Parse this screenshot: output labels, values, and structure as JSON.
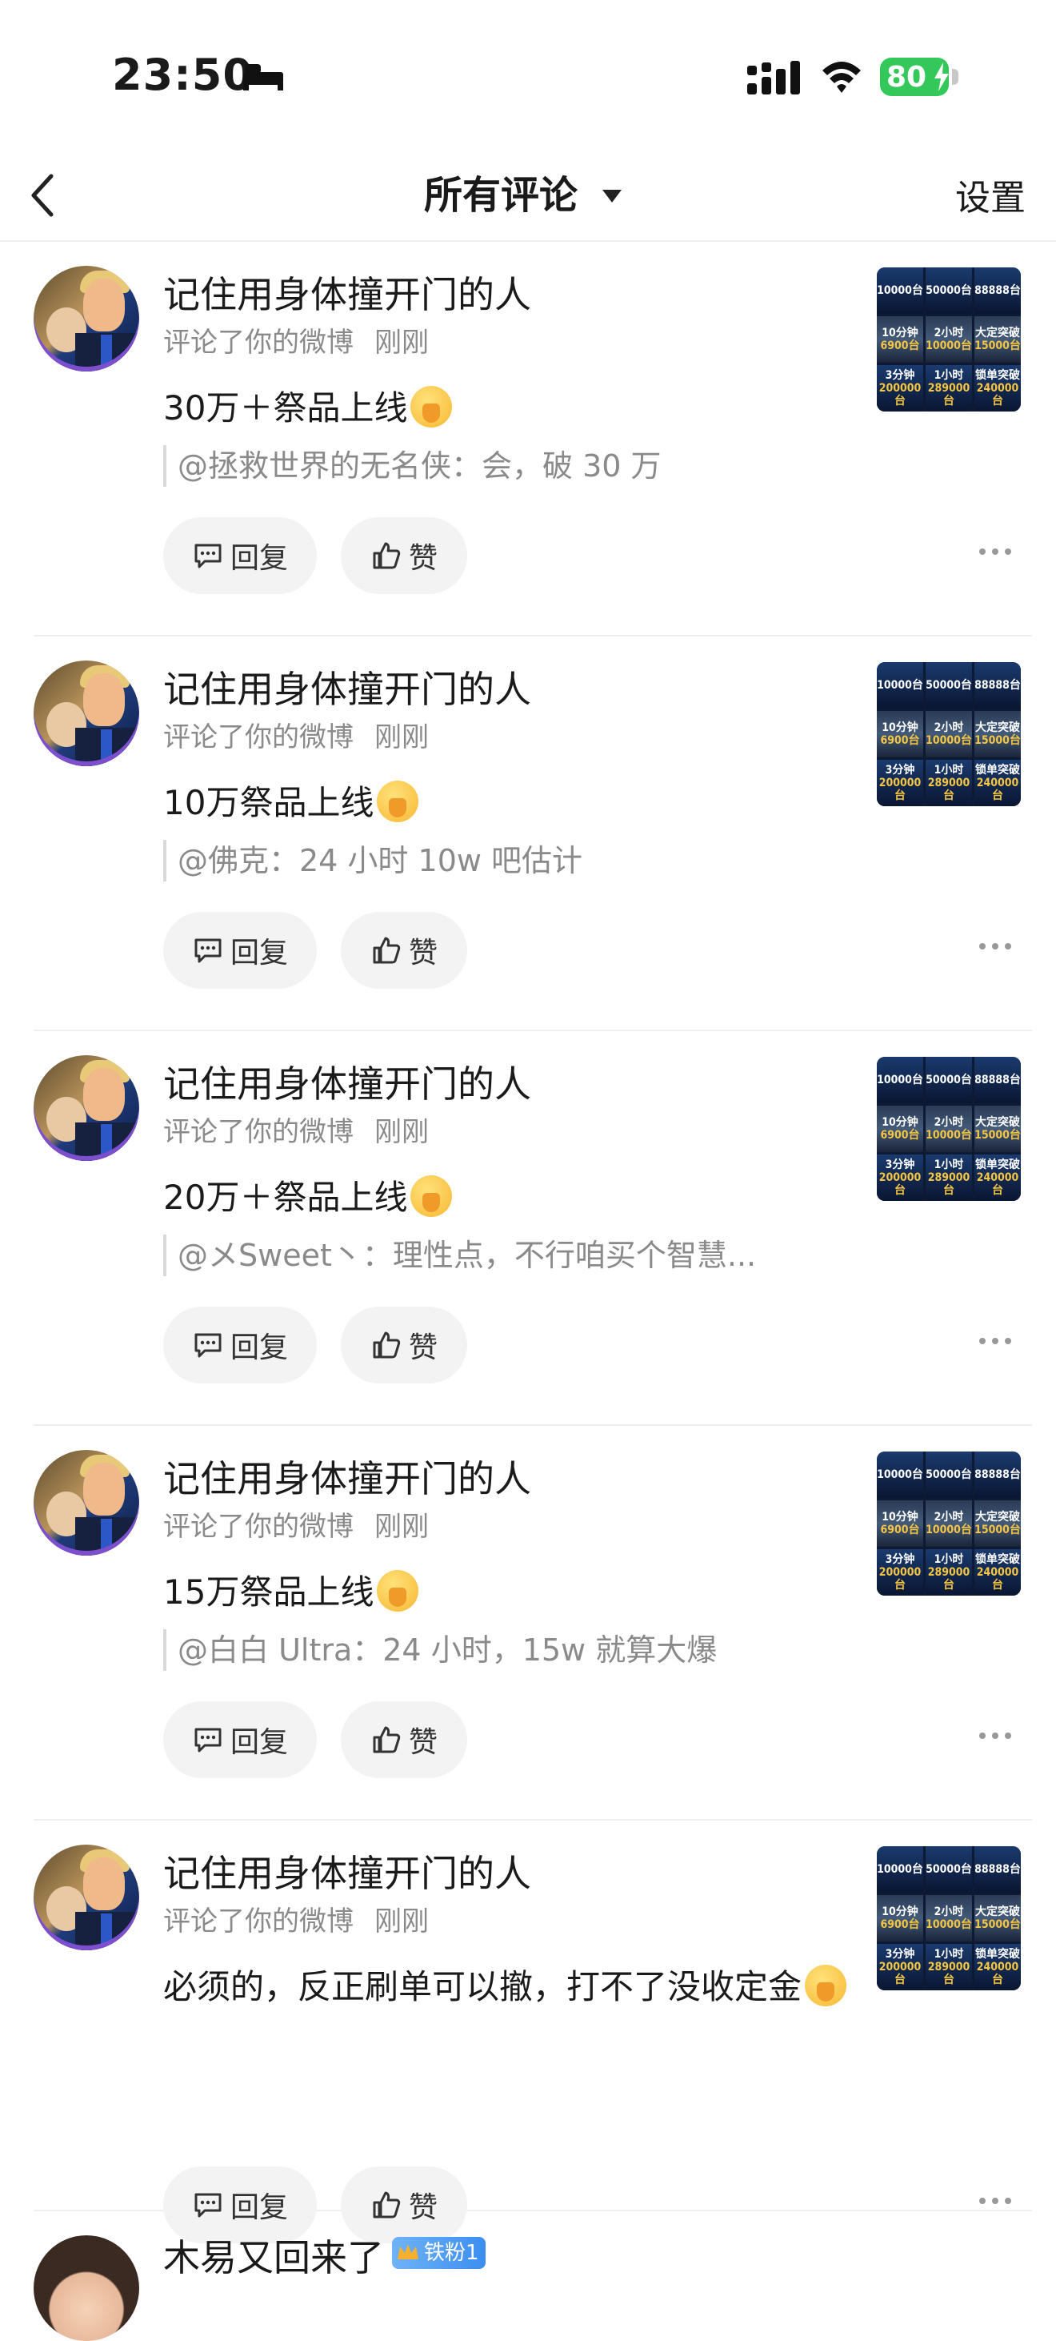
{
  "status_bar": {
    "time": "23:50",
    "battery": "80"
  },
  "nav": {
    "title": "所有评论",
    "settings": "设置"
  },
  "actions": {
    "reply": "回复",
    "like": "赞"
  },
  "comments": [
    {
      "name": "记住用身体撞开门的人",
      "action_text": "评论了你的微博",
      "time": "刚刚",
      "content": "30万＋祭品上线",
      "quote": "@拯救世界的无名侠：会，破 30 万"
    },
    {
      "name": "记住用身体撞开门的人",
      "action_text": "评论了你的微博",
      "time": "刚刚",
      "content": "10万祭品上线",
      "quote": "@佛克：24 小时 10w 吧估计"
    },
    {
      "name": "记住用身体撞开门的人",
      "action_text": "评论了你的微博",
      "time": "刚刚",
      "content": "20万＋祭品上线",
      "quote": "@メSweet丶：理性点，不行咱买个智慧..."
    },
    {
      "name": "记住用身体撞开门的人",
      "action_text": "评论了你的微博",
      "time": "刚刚",
      "content": "15万祭品上线",
      "quote": "@白白 Ultra：24 小时，15w 就算大爆"
    },
    {
      "name": "记住用身体撞开门的人",
      "action_text": "评论了你的微博",
      "time": "刚刚",
      "content": "必须的，反正刷单可以撤，打不了没收定金",
      "quote": ""
    }
  ],
  "partial_comment": {
    "name": "木易又回来了",
    "badge": "铁粉1"
  },
  "thumbnail": {
    "cells": [
      {
        "a": "10000台",
        "b": ""
      },
      {
        "a": "50000台",
        "b": ""
      },
      {
        "a": "88888台",
        "b": ""
      },
      {
        "a": "10分钟",
        "b": "6900台"
      },
      {
        "a": "2小时",
        "b": "10000台"
      },
      {
        "a": "大定突破",
        "b": "15000台"
      },
      {
        "a": "3分钟",
        "b": "200000台"
      },
      {
        "a": "1小时",
        "b": "289000台"
      },
      {
        "a": "锁单突破",
        "b": "240000台"
      }
    ]
  }
}
